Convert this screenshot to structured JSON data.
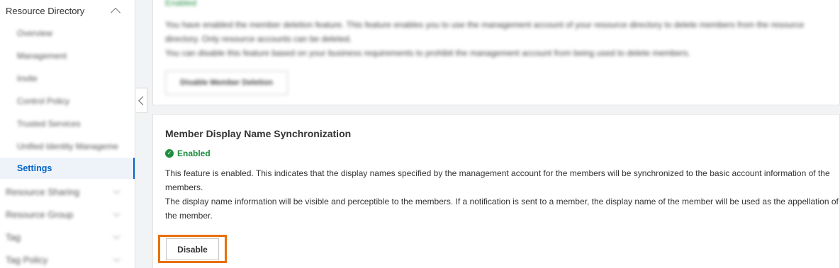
{
  "sidebar": {
    "section_title": "Resource Directory",
    "items": [
      {
        "label": "Overview"
      },
      {
        "label": "Management"
      },
      {
        "label": "Invite"
      },
      {
        "label": "Control Policy"
      },
      {
        "label": "Trusted Services"
      },
      {
        "label": "Unified Identity Manageme"
      },
      {
        "label": "Settings"
      }
    ],
    "sections": [
      {
        "label": "Resource Sharing"
      },
      {
        "label": "Resource Group"
      },
      {
        "label": "Tag"
      },
      {
        "label": "Tag Policy"
      }
    ]
  },
  "member_deletion": {
    "status": "Enabled",
    "description": "You have enabled the member deletion feature. This feature enables you to use the management account of your resource directory to delete members from the resource directory. Only resource accounts can be deleted.",
    "description2": "You can disable this feature based on your business requirements to prohibit the management account from being used to delete members.",
    "button_label": "Disable Member Deletion"
  },
  "display_name_sync": {
    "title": "Member Display Name Synchronization",
    "status": "Enabled",
    "description": "This feature is enabled. This indicates that the display names specified by the management account for the members will be synchronized to the basic account information of the members.",
    "description2": "The display name information will be visible and perceptible to the members. If a notification is sent to a member, the display name of the member will be used as the appellation of the member.",
    "button_label": "Disable"
  },
  "colors": {
    "accent": "#0064c8",
    "success": "#1e8e3e",
    "highlight": "#e8700a"
  },
  "icons": {
    "check": "✓"
  }
}
